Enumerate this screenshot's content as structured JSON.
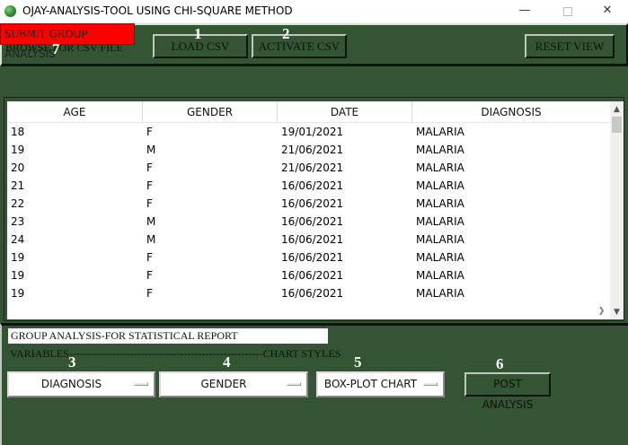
{
  "window": {
    "title": "OJAY-ANALYSIS-TOOL USING CHI-SQUARE METHOD",
    "minimize_glyph": "—",
    "close_glyph": "✕"
  },
  "toolbar": {
    "submit_label": "SUBMIT GROUP ANALYSIS",
    "browse_label": "BROWSE FOR CSV FILE",
    "load_label": "LOAD CSV",
    "activate_label": "ACTIVATE CSV",
    "reset_label": "RESET VIEW"
  },
  "step_numbers": [
    "1",
    "2",
    "3",
    "4",
    "5",
    "6",
    "7"
  ],
  "table": {
    "columns": [
      "AGE",
      "GENDER",
      "DATE",
      "DIAGNOSIS"
    ],
    "rows": [
      [
        "18",
        "F",
        "19/01/2021",
        "MALARIA"
      ],
      [
        "19",
        "M",
        "21/06/2021",
        "MALARIA"
      ],
      [
        "20",
        "F",
        "21/06/2021",
        "MALARIA"
      ],
      [
        "21",
        "F",
        "16/06/2021",
        "MALARIA"
      ],
      [
        "22",
        "F",
        "16/06/2021",
        "MALARIA"
      ],
      [
        "23",
        "M",
        "16/06/2021",
        "MALARIA"
      ],
      [
        "24",
        "M",
        "16/06/2021",
        "MALARIA"
      ],
      [
        "19",
        "F",
        "16/06/2021",
        "MALARIA"
      ],
      [
        "19",
        "F",
        "16/06/2021",
        "MALARIA"
      ],
      [
        "19",
        "F",
        "16/06/2021",
        "MALARIA"
      ]
    ]
  },
  "analysis": {
    "title": "GROUP ANALYSIS-FOR STATISTICAL REPORT",
    "variables_label": "VARIABLES",
    "dashes": "------------------------------------------------------",
    "chart_styles_label": "CHART STYLES",
    "variable_1": "DIAGNOSIS",
    "variable_2": "GENDER",
    "chart_style": "BOX-PLOT CHART",
    "post_label": "POST ANALYSIS"
  },
  "colors": {
    "background": "#335533",
    "submit_button": "#ff0000"
  }
}
